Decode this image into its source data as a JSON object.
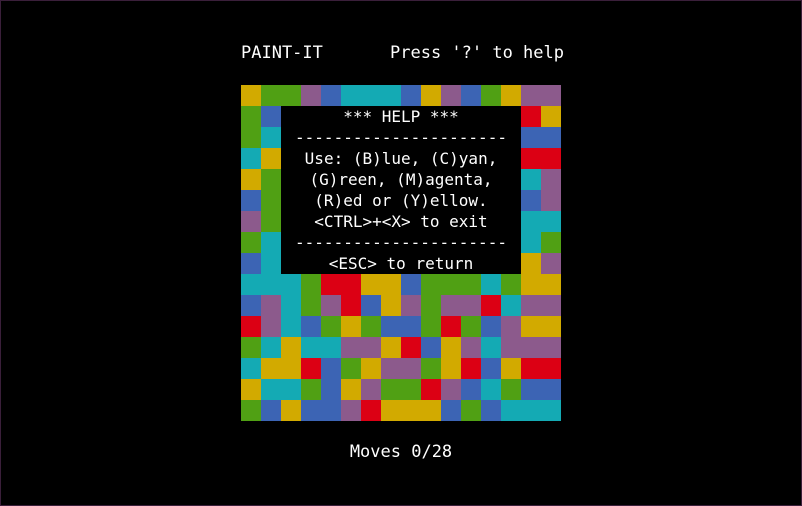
{
  "header": {
    "title": "PAINT-IT",
    "help_hint": "Press '?' to help"
  },
  "colors": {
    "B": "#3c64b4",
    "C": "#14aab4",
    "G": "#50a014",
    "M": "#8c5a8c",
    "R": "#dc0014",
    "Y": "#d2aa00"
  },
  "board": {
    "rows": [
      "YGGMBCCCBYMBGYM",
      "GBMYCMYRRBMRCGRY",
      "GCBMBYMRBGBGMRB",
      "CYCMRGMMGCRYBCRR",
      "YGGBBCMRMYRRBYCM",
      "BGMBGMCYBGBYYCBM",
      "MGRMRRYRGGBBMMCC",
      "GCYGMGRBMBGYRMCG",
      "BCYRBYCGRGYGRCYM",
      "CCCGRRYYBGGGCGY",
      "BMCGMRBYMGMMRCM",
      "RMCBGYGBBGRGBMY",
      "GCYCCMMYRBYMCMM",
      "CYYRBGYMMGYRBYR",
      "YCCGBYMGGRMBCGB",
      "GBYBBMRYYYBGBC"
    ]
  },
  "help": {
    "title": "*** HELP ***",
    "divider": "----------------------",
    "line1": "Use: (B)lue, (C)yan,",
    "line2": "(G)reen, (M)agenta,",
    "line3": "(R)ed or (Y)ellow.",
    "line4": "<CTRL>+<X> to exit",
    "divider2": "----------------------",
    "return": "<ESC> to return"
  },
  "status": {
    "moves": "Moves 0/28"
  }
}
